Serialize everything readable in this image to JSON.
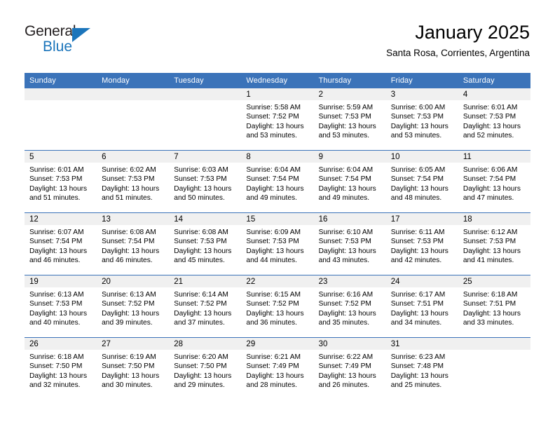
{
  "brand": {
    "name_top": "General",
    "name_bottom": "Blue",
    "accent_color": "#1b75bb"
  },
  "header": {
    "title": "January 2025",
    "subtitle": "Santa Rosa, Corrientes, Argentina"
  },
  "theme": {
    "header_row_color": "#3b73b9",
    "daynum_band_color": "#f0f0f0",
    "row_divider_color": "#3b73b9",
    "text_color": "#000000"
  },
  "calendar": {
    "weekday_headers": [
      "Sunday",
      "Monday",
      "Tuesday",
      "Wednesday",
      "Thursday",
      "Friday",
      "Saturday"
    ],
    "labels": {
      "sunrise": "Sunrise:",
      "sunset": "Sunset:",
      "daylight": "Daylight:"
    },
    "weeks": [
      [
        {
          "day": "",
          "empty": true
        },
        {
          "day": "",
          "empty": true
        },
        {
          "day": "",
          "empty": true
        },
        {
          "day": "1",
          "sunrise": "Sunrise: 5:58 AM",
          "sunset": "Sunset: 7:52 PM",
          "daylight_l1": "Daylight: 13 hours",
          "daylight_l2": "and 53 minutes."
        },
        {
          "day": "2",
          "sunrise": "Sunrise: 5:59 AM",
          "sunset": "Sunset: 7:53 PM",
          "daylight_l1": "Daylight: 13 hours",
          "daylight_l2": "and 53 minutes."
        },
        {
          "day": "3",
          "sunrise": "Sunrise: 6:00 AM",
          "sunset": "Sunset: 7:53 PM",
          "daylight_l1": "Daylight: 13 hours",
          "daylight_l2": "and 53 minutes."
        },
        {
          "day": "4",
          "sunrise": "Sunrise: 6:01 AM",
          "sunset": "Sunset: 7:53 PM",
          "daylight_l1": "Daylight: 13 hours",
          "daylight_l2": "and 52 minutes."
        }
      ],
      [
        {
          "day": "5",
          "sunrise": "Sunrise: 6:01 AM",
          "sunset": "Sunset: 7:53 PM",
          "daylight_l1": "Daylight: 13 hours",
          "daylight_l2": "and 51 minutes."
        },
        {
          "day": "6",
          "sunrise": "Sunrise: 6:02 AM",
          "sunset": "Sunset: 7:53 PM",
          "daylight_l1": "Daylight: 13 hours",
          "daylight_l2": "and 51 minutes."
        },
        {
          "day": "7",
          "sunrise": "Sunrise: 6:03 AM",
          "sunset": "Sunset: 7:53 PM",
          "daylight_l1": "Daylight: 13 hours",
          "daylight_l2": "and 50 minutes."
        },
        {
          "day": "8",
          "sunrise": "Sunrise: 6:04 AM",
          "sunset": "Sunset: 7:54 PM",
          "daylight_l1": "Daylight: 13 hours",
          "daylight_l2": "and 49 minutes."
        },
        {
          "day": "9",
          "sunrise": "Sunrise: 6:04 AM",
          "sunset": "Sunset: 7:54 PM",
          "daylight_l1": "Daylight: 13 hours",
          "daylight_l2": "and 49 minutes."
        },
        {
          "day": "10",
          "sunrise": "Sunrise: 6:05 AM",
          "sunset": "Sunset: 7:54 PM",
          "daylight_l1": "Daylight: 13 hours",
          "daylight_l2": "and 48 minutes."
        },
        {
          "day": "11",
          "sunrise": "Sunrise: 6:06 AM",
          "sunset": "Sunset: 7:54 PM",
          "daylight_l1": "Daylight: 13 hours",
          "daylight_l2": "and 47 minutes."
        }
      ],
      [
        {
          "day": "12",
          "sunrise": "Sunrise: 6:07 AM",
          "sunset": "Sunset: 7:54 PM",
          "daylight_l1": "Daylight: 13 hours",
          "daylight_l2": "and 46 minutes."
        },
        {
          "day": "13",
          "sunrise": "Sunrise: 6:08 AM",
          "sunset": "Sunset: 7:54 PM",
          "daylight_l1": "Daylight: 13 hours",
          "daylight_l2": "and 46 minutes."
        },
        {
          "day": "14",
          "sunrise": "Sunrise: 6:08 AM",
          "sunset": "Sunset: 7:53 PM",
          "daylight_l1": "Daylight: 13 hours",
          "daylight_l2": "and 45 minutes."
        },
        {
          "day": "15",
          "sunrise": "Sunrise: 6:09 AM",
          "sunset": "Sunset: 7:53 PM",
          "daylight_l1": "Daylight: 13 hours",
          "daylight_l2": "and 44 minutes."
        },
        {
          "day": "16",
          "sunrise": "Sunrise: 6:10 AM",
          "sunset": "Sunset: 7:53 PM",
          "daylight_l1": "Daylight: 13 hours",
          "daylight_l2": "and 43 minutes."
        },
        {
          "day": "17",
          "sunrise": "Sunrise: 6:11 AM",
          "sunset": "Sunset: 7:53 PM",
          "daylight_l1": "Daylight: 13 hours",
          "daylight_l2": "and 42 minutes."
        },
        {
          "day": "18",
          "sunrise": "Sunrise: 6:12 AM",
          "sunset": "Sunset: 7:53 PM",
          "daylight_l1": "Daylight: 13 hours",
          "daylight_l2": "and 41 minutes."
        }
      ],
      [
        {
          "day": "19",
          "sunrise": "Sunrise: 6:13 AM",
          "sunset": "Sunset: 7:53 PM",
          "daylight_l1": "Daylight: 13 hours",
          "daylight_l2": "and 40 minutes."
        },
        {
          "day": "20",
          "sunrise": "Sunrise: 6:13 AM",
          "sunset": "Sunset: 7:52 PM",
          "daylight_l1": "Daylight: 13 hours",
          "daylight_l2": "and 39 minutes."
        },
        {
          "day": "21",
          "sunrise": "Sunrise: 6:14 AM",
          "sunset": "Sunset: 7:52 PM",
          "daylight_l1": "Daylight: 13 hours",
          "daylight_l2": "and 37 minutes."
        },
        {
          "day": "22",
          "sunrise": "Sunrise: 6:15 AM",
          "sunset": "Sunset: 7:52 PM",
          "daylight_l1": "Daylight: 13 hours",
          "daylight_l2": "and 36 minutes."
        },
        {
          "day": "23",
          "sunrise": "Sunrise: 6:16 AM",
          "sunset": "Sunset: 7:52 PM",
          "daylight_l1": "Daylight: 13 hours",
          "daylight_l2": "and 35 minutes."
        },
        {
          "day": "24",
          "sunrise": "Sunrise: 6:17 AM",
          "sunset": "Sunset: 7:51 PM",
          "daylight_l1": "Daylight: 13 hours",
          "daylight_l2": "and 34 minutes."
        },
        {
          "day": "25",
          "sunrise": "Sunrise: 6:18 AM",
          "sunset": "Sunset: 7:51 PM",
          "daylight_l1": "Daylight: 13 hours",
          "daylight_l2": "and 33 minutes."
        }
      ],
      [
        {
          "day": "26",
          "sunrise": "Sunrise: 6:18 AM",
          "sunset": "Sunset: 7:50 PM",
          "daylight_l1": "Daylight: 13 hours",
          "daylight_l2": "and 32 minutes."
        },
        {
          "day": "27",
          "sunrise": "Sunrise: 6:19 AM",
          "sunset": "Sunset: 7:50 PM",
          "daylight_l1": "Daylight: 13 hours",
          "daylight_l2": "and 30 minutes."
        },
        {
          "day": "28",
          "sunrise": "Sunrise: 6:20 AM",
          "sunset": "Sunset: 7:50 PM",
          "daylight_l1": "Daylight: 13 hours",
          "daylight_l2": "and 29 minutes."
        },
        {
          "day": "29",
          "sunrise": "Sunrise: 6:21 AM",
          "sunset": "Sunset: 7:49 PM",
          "daylight_l1": "Daylight: 13 hours",
          "daylight_l2": "and 28 minutes."
        },
        {
          "day": "30",
          "sunrise": "Sunrise: 6:22 AM",
          "sunset": "Sunset: 7:49 PM",
          "daylight_l1": "Daylight: 13 hours",
          "daylight_l2": "and 26 minutes."
        },
        {
          "day": "31",
          "sunrise": "Sunrise: 6:23 AM",
          "sunset": "Sunset: 7:48 PM",
          "daylight_l1": "Daylight: 13 hours",
          "daylight_l2": "and 25 minutes."
        },
        {
          "day": "",
          "empty": true
        }
      ]
    ]
  }
}
